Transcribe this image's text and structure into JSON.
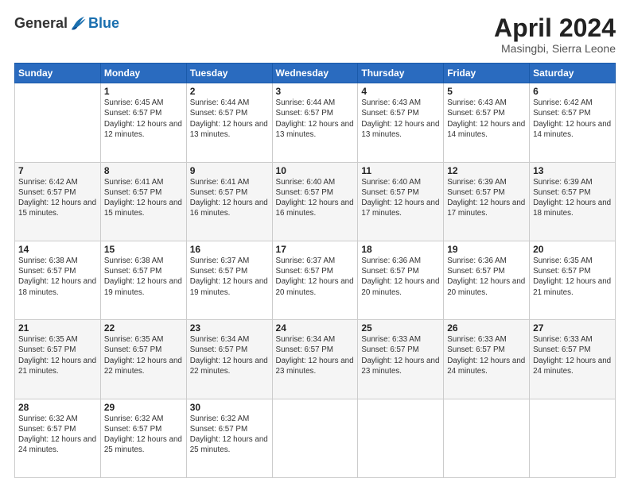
{
  "header": {
    "logo_general": "General",
    "logo_blue": "Blue",
    "month_title": "April 2024",
    "subtitle": "Masingbi, Sierra Leone"
  },
  "days_of_week": [
    "Sunday",
    "Monday",
    "Tuesday",
    "Wednesday",
    "Thursday",
    "Friday",
    "Saturday"
  ],
  "weeks": [
    [
      {
        "day": "",
        "sunrise": "",
        "sunset": "",
        "daylight": ""
      },
      {
        "day": "1",
        "sunrise": "Sunrise: 6:45 AM",
        "sunset": "Sunset: 6:57 PM",
        "daylight": "Daylight: 12 hours and 12 minutes."
      },
      {
        "day": "2",
        "sunrise": "Sunrise: 6:44 AM",
        "sunset": "Sunset: 6:57 PM",
        "daylight": "Daylight: 12 hours and 13 minutes."
      },
      {
        "day": "3",
        "sunrise": "Sunrise: 6:44 AM",
        "sunset": "Sunset: 6:57 PM",
        "daylight": "Daylight: 12 hours and 13 minutes."
      },
      {
        "day": "4",
        "sunrise": "Sunrise: 6:43 AM",
        "sunset": "Sunset: 6:57 PM",
        "daylight": "Daylight: 12 hours and 13 minutes."
      },
      {
        "day": "5",
        "sunrise": "Sunrise: 6:43 AM",
        "sunset": "Sunset: 6:57 PM",
        "daylight": "Daylight: 12 hours and 14 minutes."
      },
      {
        "day": "6",
        "sunrise": "Sunrise: 6:42 AM",
        "sunset": "Sunset: 6:57 PM",
        "daylight": "Daylight: 12 hours and 14 minutes."
      }
    ],
    [
      {
        "day": "7",
        "sunrise": "Sunrise: 6:42 AM",
        "sunset": "Sunset: 6:57 PM",
        "daylight": "Daylight: 12 hours and 15 minutes."
      },
      {
        "day": "8",
        "sunrise": "Sunrise: 6:41 AM",
        "sunset": "Sunset: 6:57 PM",
        "daylight": "Daylight: 12 hours and 15 minutes."
      },
      {
        "day": "9",
        "sunrise": "Sunrise: 6:41 AM",
        "sunset": "Sunset: 6:57 PM",
        "daylight": "Daylight: 12 hours and 16 minutes."
      },
      {
        "day": "10",
        "sunrise": "Sunrise: 6:40 AM",
        "sunset": "Sunset: 6:57 PM",
        "daylight": "Daylight: 12 hours and 16 minutes."
      },
      {
        "day": "11",
        "sunrise": "Sunrise: 6:40 AM",
        "sunset": "Sunset: 6:57 PM",
        "daylight": "Daylight: 12 hours and 17 minutes."
      },
      {
        "day": "12",
        "sunrise": "Sunrise: 6:39 AM",
        "sunset": "Sunset: 6:57 PM",
        "daylight": "Daylight: 12 hours and 17 minutes."
      },
      {
        "day": "13",
        "sunrise": "Sunrise: 6:39 AM",
        "sunset": "Sunset: 6:57 PM",
        "daylight": "Daylight: 12 hours and 18 minutes."
      }
    ],
    [
      {
        "day": "14",
        "sunrise": "Sunrise: 6:38 AM",
        "sunset": "Sunset: 6:57 PM",
        "daylight": "Daylight: 12 hours and 18 minutes."
      },
      {
        "day": "15",
        "sunrise": "Sunrise: 6:38 AM",
        "sunset": "Sunset: 6:57 PM",
        "daylight": "Daylight: 12 hours and 19 minutes."
      },
      {
        "day": "16",
        "sunrise": "Sunrise: 6:37 AM",
        "sunset": "Sunset: 6:57 PM",
        "daylight": "Daylight: 12 hours and 19 minutes."
      },
      {
        "day": "17",
        "sunrise": "Sunrise: 6:37 AM",
        "sunset": "Sunset: 6:57 PM",
        "daylight": "Daylight: 12 hours and 20 minutes."
      },
      {
        "day": "18",
        "sunrise": "Sunrise: 6:36 AM",
        "sunset": "Sunset: 6:57 PM",
        "daylight": "Daylight: 12 hours and 20 minutes."
      },
      {
        "day": "19",
        "sunrise": "Sunrise: 6:36 AM",
        "sunset": "Sunset: 6:57 PM",
        "daylight": "Daylight: 12 hours and 20 minutes."
      },
      {
        "day": "20",
        "sunrise": "Sunrise: 6:35 AM",
        "sunset": "Sunset: 6:57 PM",
        "daylight": "Daylight: 12 hours and 21 minutes."
      }
    ],
    [
      {
        "day": "21",
        "sunrise": "Sunrise: 6:35 AM",
        "sunset": "Sunset: 6:57 PM",
        "daylight": "Daylight: 12 hours and 21 minutes."
      },
      {
        "day": "22",
        "sunrise": "Sunrise: 6:35 AM",
        "sunset": "Sunset: 6:57 PM",
        "daylight": "Daylight: 12 hours and 22 minutes."
      },
      {
        "day": "23",
        "sunrise": "Sunrise: 6:34 AM",
        "sunset": "Sunset: 6:57 PM",
        "daylight": "Daylight: 12 hours and 22 minutes."
      },
      {
        "day": "24",
        "sunrise": "Sunrise: 6:34 AM",
        "sunset": "Sunset: 6:57 PM",
        "daylight": "Daylight: 12 hours and 23 minutes."
      },
      {
        "day": "25",
        "sunrise": "Sunrise: 6:33 AM",
        "sunset": "Sunset: 6:57 PM",
        "daylight": "Daylight: 12 hours and 23 minutes."
      },
      {
        "day": "26",
        "sunrise": "Sunrise: 6:33 AM",
        "sunset": "Sunset: 6:57 PM",
        "daylight": "Daylight: 12 hours and 24 minutes."
      },
      {
        "day": "27",
        "sunrise": "Sunrise: 6:33 AM",
        "sunset": "Sunset: 6:57 PM",
        "daylight": "Daylight: 12 hours and 24 minutes."
      }
    ],
    [
      {
        "day": "28",
        "sunrise": "Sunrise: 6:32 AM",
        "sunset": "Sunset: 6:57 PM",
        "daylight": "Daylight: 12 hours and 24 minutes."
      },
      {
        "day": "29",
        "sunrise": "Sunrise: 6:32 AM",
        "sunset": "Sunset: 6:57 PM",
        "daylight": "Daylight: 12 hours and 25 minutes."
      },
      {
        "day": "30",
        "sunrise": "Sunrise: 6:32 AM",
        "sunset": "Sunset: 6:57 PM",
        "daylight": "Daylight: 12 hours and 25 minutes."
      },
      {
        "day": "",
        "sunrise": "",
        "sunset": "",
        "daylight": ""
      },
      {
        "day": "",
        "sunrise": "",
        "sunset": "",
        "daylight": ""
      },
      {
        "day": "",
        "sunrise": "",
        "sunset": "",
        "daylight": ""
      },
      {
        "day": "",
        "sunrise": "",
        "sunset": "",
        "daylight": ""
      }
    ]
  ]
}
